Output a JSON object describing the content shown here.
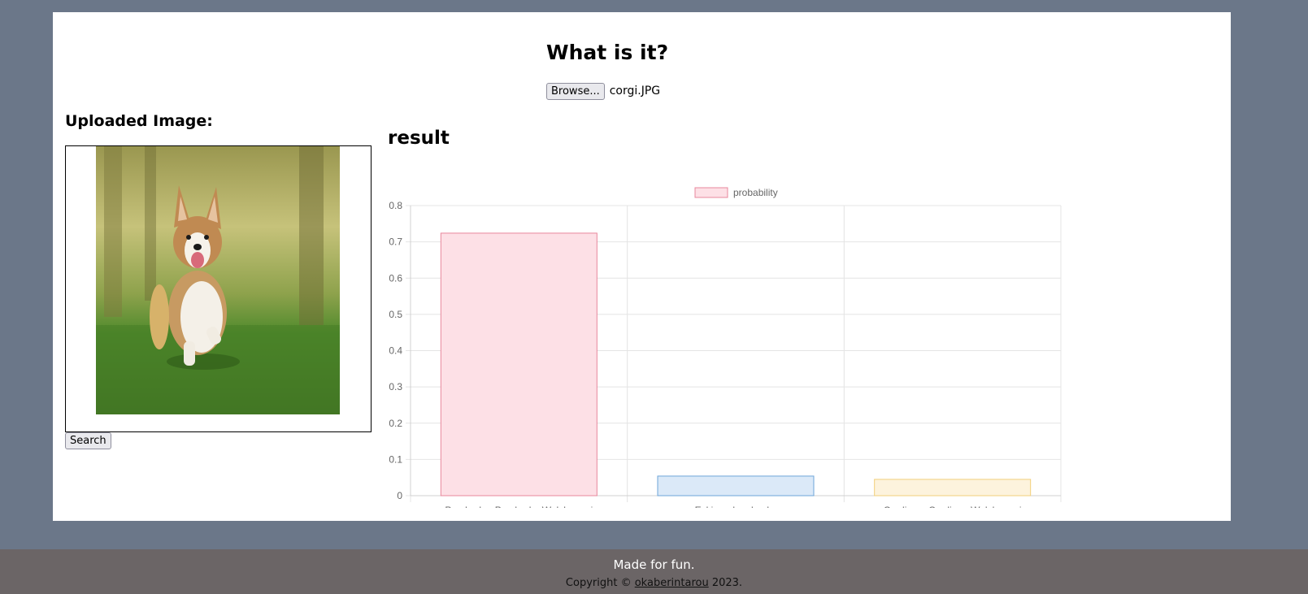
{
  "header": {
    "title": "What is it?",
    "browse_label": "Browse...",
    "file_name": "corgi.JPG"
  },
  "uploaded": {
    "heading": "Uploaded Image:",
    "image_subject": "corgi running on grass",
    "search_label": "Search"
  },
  "result": {
    "heading": "result"
  },
  "chart_data": {
    "type": "bar",
    "categories": [
      "Pembroke, Pembroke Welsh corgi",
      "Eskimo dog, husky",
      "Cardigan, Cardigan Welsh corgi"
    ],
    "series": [
      {
        "name": "probability",
        "values": [
          0.724,
          0.054,
          0.045
        ]
      }
    ],
    "ylim": [
      0,
      0.8
    ],
    "yticks": [
      "0",
      "0.1",
      "0.2",
      "0.3",
      "0.4",
      "0.5",
      "0.6",
      "0.7",
      "0.8"
    ],
    "legend_position": "top-center",
    "grid": true,
    "bar_fills": [
      "#fde0e6",
      "#dbe9f8",
      "#fdf3dd"
    ],
    "bar_strokes": [
      "#e8879c",
      "#6ea5d8",
      "#f2cf7a"
    ]
  },
  "footer": {
    "main": "Made for fun.",
    "copyright_prefix": "Copyright ©",
    "author": "okaberintarou",
    "year": "2023."
  }
}
